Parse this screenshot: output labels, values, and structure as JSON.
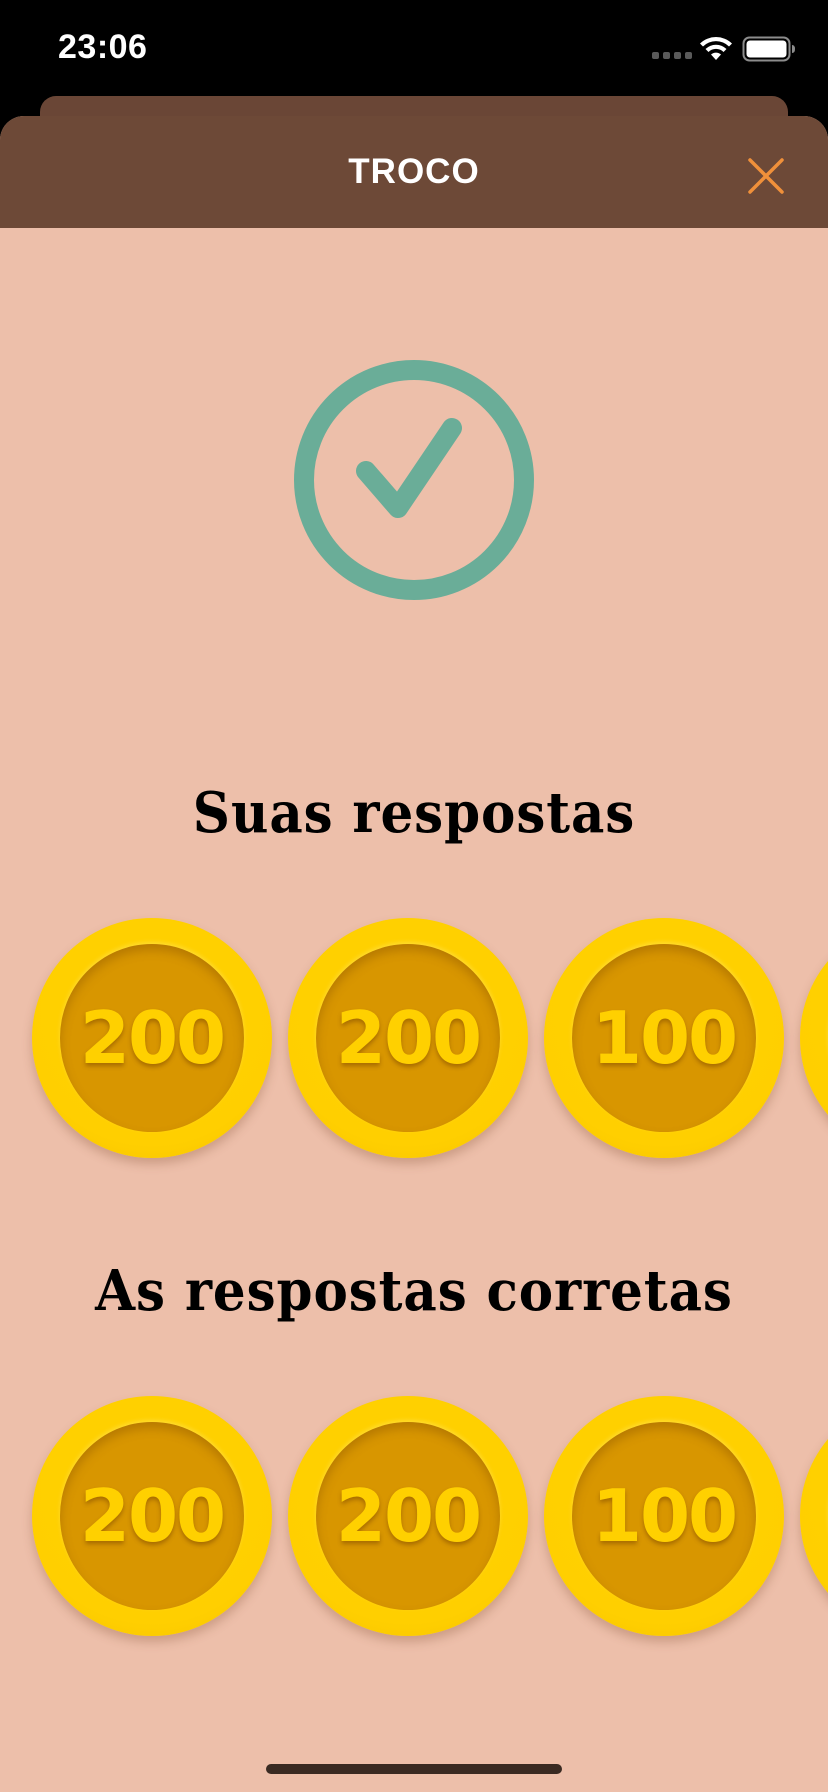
{
  "status_bar": {
    "time": "23:06",
    "icons": [
      "cellular-signal-icon",
      "wifi-icon",
      "battery-icon"
    ]
  },
  "header": {
    "title": "TROCO",
    "close_icon": "close-icon",
    "background_color": "#6d4937",
    "close_color": "#f0903a"
  },
  "result": {
    "icon": "checkmark-circle-icon",
    "color": "#6aad98"
  },
  "your_answers": {
    "title": "Suas respostas",
    "coins": [
      "200",
      "200",
      "100",
      ""
    ]
  },
  "correct_answers": {
    "title": "As respostas corretas",
    "coins": [
      "200",
      "200",
      "100",
      ""
    ]
  },
  "colors": {
    "background": "#edbfaa",
    "coin_outer": "#ffd000",
    "coin_inner": "#d89600"
  }
}
